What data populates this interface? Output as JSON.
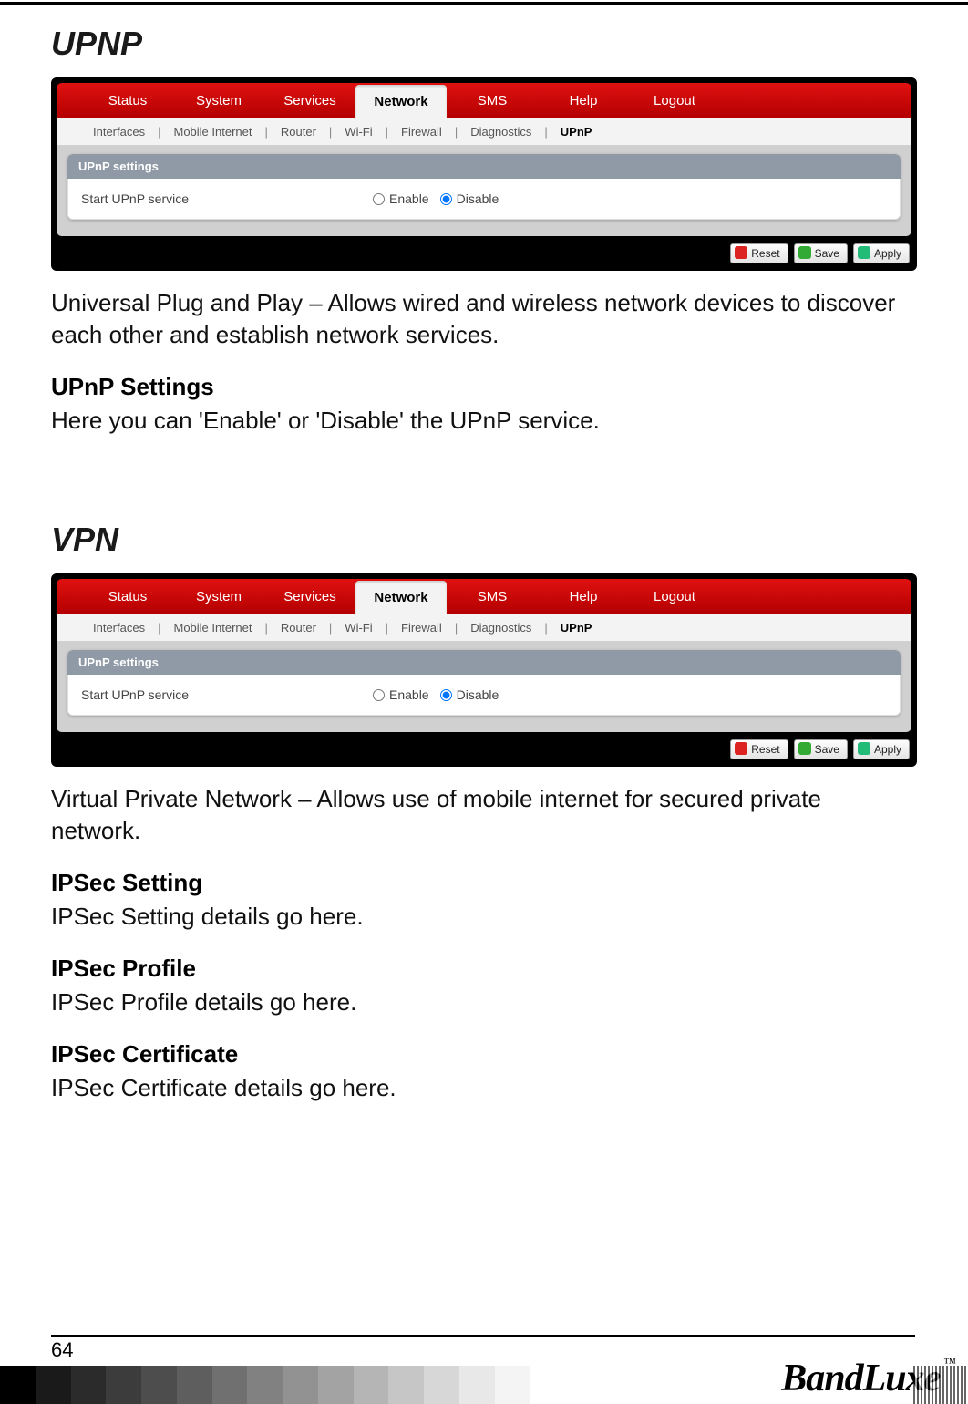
{
  "page_number": "64",
  "brand": "BandLuxe",
  "brand_tm": "™",
  "sections": {
    "upnp": {
      "title": "UPNP",
      "description": "Universal Plug and Play – Allows wired and wireless network devices to discover each other and establish network services.",
      "sub_heading": "UPnP Settings",
      "sub_text": "Here you can 'Enable' or 'Disable' the UPnP service."
    },
    "vpn": {
      "title": "VPN",
      "description": "Virtual Private Network – Allows use of mobile internet for secured private network.",
      "items": [
        {
          "h": "IPSec Setting",
          "p": "IPSec Setting details go here."
        },
        {
          "h": "IPSec Profile",
          "p": "IPSec Profile details go here."
        },
        {
          "h": "IPSec Certificate",
          "p": "IPSec Certificate details go here."
        }
      ]
    }
  },
  "router_ui": {
    "nav": [
      "Status",
      "System",
      "Services",
      "Network",
      "SMS",
      "Help",
      "Logout"
    ],
    "nav_active": "Network",
    "subnav": [
      "Interfaces",
      "Mobile Internet",
      "Router",
      "Wi-Fi",
      "Firewall",
      "Diagnostics",
      "UPnP"
    ],
    "subnav_active": "UPnP",
    "card_title": "UPnP settings",
    "field_label": "Start UPnP service",
    "radio_enable": "Enable",
    "radio_disable": "Disable",
    "buttons": {
      "reset": "Reset",
      "save": "Save",
      "apply": "Apply"
    }
  },
  "gradient_colors": [
    "#000000",
    "#1a1a1a",
    "#2b2b2b",
    "#3c3c3c",
    "#4d4d4d",
    "#5e5e5e",
    "#707070",
    "#818181",
    "#929292",
    "#a3a3a3",
    "#b5b5b5",
    "#c6c6c6",
    "#d7d7d7",
    "#e8e8e8",
    "#f4f4f4",
    "#ffffff"
  ]
}
